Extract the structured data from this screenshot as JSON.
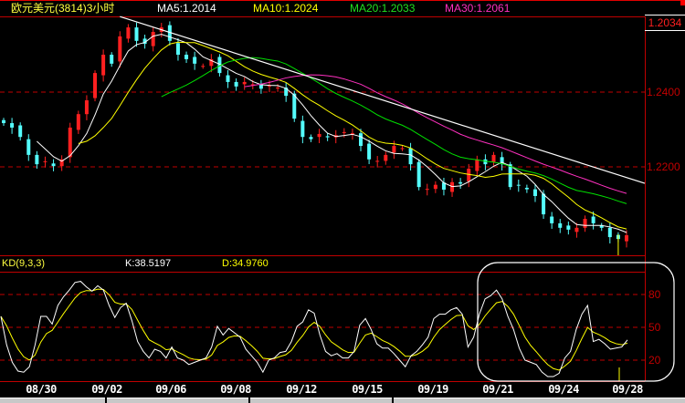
{
  "header": {
    "title": "欧元美元(3814)3小时",
    "ma5": "MA5:1.2014",
    "ma10": "MA10:1.2024",
    "ma20": "MA20:1.2033",
    "ma30": "MA30:1.2061"
  },
  "current_price": "1.2034",
  "price_axis": [
    "1.2400",
    "1.2200"
  ],
  "kd": {
    "label": "KD(9,3,3)",
    "k": "K:38.5197",
    "d": "D:34.9760",
    "axis": [
      "80",
      "50",
      "20"
    ]
  },
  "dates": [
    "08/30",
    "09/02",
    "09/06",
    "09/08",
    "09/12",
    "09/15",
    "09/19",
    "09/21",
    "09/24",
    "09/28"
  ],
  "colors": {
    "up": "#ff2020",
    "down": "#54fcfc",
    "ma5": "#ffffff",
    "ma10": "#ffff00",
    "ma20": "#00e000",
    "ma30": "#ff30c0",
    "grid": "#c00000"
  },
  "chart_data": [
    {
      "type": "candlestick",
      "title": "欧元美元(3814)3小时",
      "ylim": [
        1.196,
        1.261
      ],
      "y_ticks": [
        1.24,
        1.22
      ],
      "closes": [
        1.2317,
        1.2305,
        1.228,
        1.2232,
        1.2207,
        1.2215,
        1.2202,
        1.222,
        1.2305,
        1.2341,
        1.2378,
        1.2451,
        1.25,
        1.2476,
        1.2549,
        1.2573,
        1.2537,
        1.2529,
        1.2561,
        1.2573,
        1.2537,
        1.25,
        1.2488,
        1.2476,
        1.247,
        1.2488,
        1.2451,
        1.2427,
        1.2415,
        1.2427,
        1.2421,
        1.2409,
        1.2418,
        1.2412,
        1.239,
        1.2329,
        1.228,
        1.2274,
        1.2288,
        1.2279,
        1.2285,
        1.2293,
        1.229,
        1.2256,
        1.222,
        1.2216,
        1.2232,
        1.2256,
        1.225,
        1.2207,
        1.2146,
        1.2141,
        1.2152,
        1.2139,
        1.2159,
        1.2155,
        1.2195,
        1.222,
        1.2207,
        1.2232,
        1.2207,
        1.2146,
        1.215,
        1.214,
        1.2122,
        1.2073,
        1.2049,
        1.2037,
        1.2032,
        1.2037,
        1.2061,
        1.2049,
        1.2037,
        1.2012,
        1.2007,
        1.2017
      ],
      "moving_averages": [
        5,
        10,
        20,
        30
      ],
      "trendline": {
        "from_index": 14,
        "from_price": 1.2602,
        "to_index": 77.2,
        "to_price": 1.2156
      },
      "cursor_index": 74
    },
    {
      "type": "line",
      "title": "KD(9,3,3)",
      "ylim": [
        0,
        100
      ],
      "y_ticks": [
        80,
        50,
        20
      ],
      "series": [
        {
          "name": "K",
          "values": [
            60,
            34,
            18,
            10,
            9,
            14,
            34,
            60,
            60,
            53,
            70,
            78,
            84,
            91,
            92,
            87,
            83,
            88,
            84,
            70,
            59,
            68,
            72,
            56,
            37,
            28,
            22,
            30,
            28,
            22,
            32,
            22,
            20,
            16,
            18,
            20,
            22,
            32,
            51,
            43,
            49,
            45,
            41,
            30,
            24,
            18,
            9,
            20,
            22,
            27,
            28,
            37,
            51,
            55,
            66,
            63,
            43,
            28,
            24,
            26,
            22,
            22,
            28,
            52,
            58,
            48,
            35,
            31,
            31,
            26,
            20,
            14,
            24,
            28,
            34,
            41,
            58,
            62,
            62,
            66,
            68,
            62,
            32,
            41,
            62,
            76,
            79,
            84,
            76,
            60,
            48,
            31,
            20,
            18,
            16,
            9,
            5,
            5,
            8,
            22,
            28,
            48,
            62,
            70,
            37,
            39,
            35,
            30,
            31,
            32,
            38.52
          ]
        },
        {
          "name": "D",
          "last": 34.976
        }
      ]
    }
  ]
}
